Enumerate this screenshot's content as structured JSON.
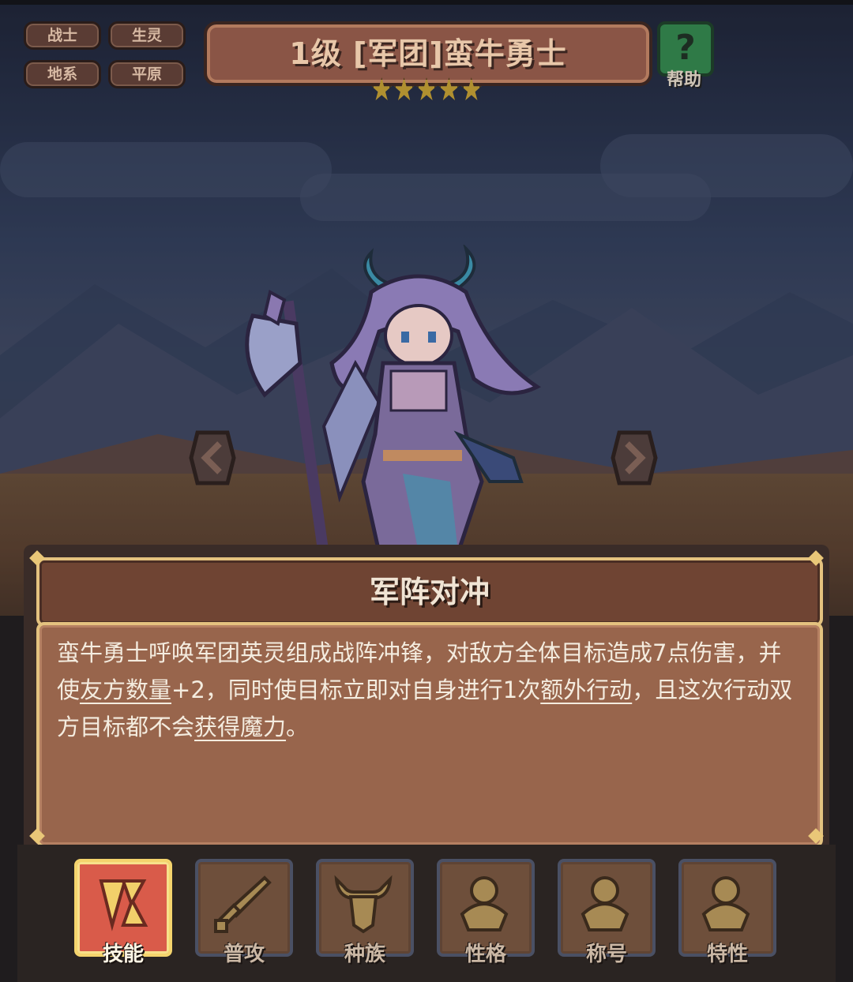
{
  "tags": [
    "战士",
    "生灵",
    "地系",
    "平原"
  ],
  "header": {
    "title": "1级 [军团]蛮牛勇士",
    "stars": 5,
    "help_label": "帮助",
    "help_glyph": "?"
  },
  "skill": {
    "name": "军阵对冲",
    "desc": {
      "p1": "蛮牛勇士呼唤军团英灵组成战阵冲锋，对敌方全体目标造成7点伤害，并使",
      "k1": "友方数量",
      "p2": "+2，同时使目标立即对自身进行1次",
      "k2": "额外行动",
      "p3": "，且这次行动双方目标都不会",
      "k3": "获得魔力",
      "p4": "。"
    }
  },
  "tabs": [
    {
      "label": "技能",
      "icon": "skill-icon",
      "active": true
    },
    {
      "label": "普攻",
      "icon": "sword-icon",
      "active": false
    },
    {
      "label": "种族",
      "icon": "bull-head-icon",
      "active": false
    },
    {
      "label": "性格",
      "icon": "personality-icon",
      "active": false
    },
    {
      "label": "称号",
      "icon": "title-badge-icon",
      "active": false
    },
    {
      "label": "特性",
      "icon": "trait-icon",
      "active": false
    }
  ],
  "colors": {
    "panel_body": "#98654c",
    "panel_border": "#e4c27f",
    "active_tab": "#d95b4a",
    "help_green": "#2f7a47"
  }
}
